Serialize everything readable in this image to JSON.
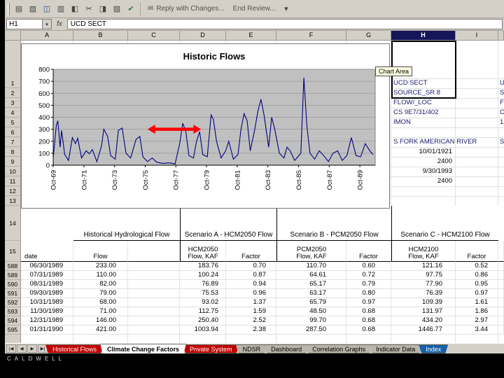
{
  "toolbar": {
    "icons": [
      {
        "name": "new-workbook",
        "glyph": "▤"
      },
      {
        "name": "open",
        "glyph": "▧"
      },
      {
        "name": "save",
        "glyph": "◫"
      },
      {
        "name": "print",
        "glyph": "▥"
      },
      {
        "name": "print-preview",
        "glyph": "◧"
      },
      {
        "name": "cut",
        "glyph": "✂"
      },
      {
        "name": "copy",
        "glyph": "◨"
      },
      {
        "name": "chart-wizard",
        "glyph": "▨"
      },
      {
        "name": "accept-change",
        "glyph": "✔"
      }
    ],
    "reply_icon_glyph": "✉",
    "reply_with_changes": "Reply with Changes...",
    "end_review": "End Review...",
    "overflow_glyph": "▾"
  },
  "formula_bar": {
    "name_box": "H1",
    "dropdown_glyph": "▾",
    "fx_label": "fx",
    "value": "UCD SECT"
  },
  "grid": {
    "columns": [
      "A",
      "B",
      "C",
      "D",
      "E",
      "F",
      "G",
      "H",
      "I"
    ],
    "selected_column": "H",
    "upper_row_numbers": [
      "1",
      "2",
      "3",
      "4",
      "5",
      "6",
      "7",
      "8",
      "9",
      "10",
      "11",
      "12",
      "13",
      "14",
      "15"
    ],
    "lower_row_numbers": [
      "588",
      "589",
      "590",
      "591",
      "592",
      "593",
      "594",
      "595"
    ]
  },
  "right_panel": {
    "h_cells": [
      "UCD SECT",
      "SOURCE_SR 8",
      "FLOW/_LOC",
      "CS 9E7/31/402",
      "IMON",
      "",
      "S FORK AMERICAN RIVER",
      "10/01/1921",
      "2400",
      "9/30/1993",
      "2400"
    ],
    "next_column_cells": [
      "U",
      "S",
      "F",
      "C",
      "1",
      "",
      "S",
      "",
      "",
      "",
      ""
    ]
  },
  "tooltip": {
    "label": "Chart Area"
  },
  "chart_data": {
    "type": "line",
    "title": "Historic Flows",
    "xlabel": "",
    "ylabel": "",
    "ylim": [
      0,
      800
    ],
    "y_ticks": [
      800,
      700,
      600,
      500,
      400,
      300,
      200,
      100,
      0
    ],
    "x_domain": [
      1969.75,
      1990.75
    ],
    "x_ticks": [
      1969.75,
      1971.75,
      1973.75,
      1975.75,
      1977.75,
      1979.75,
      1981.75,
      1983.75,
      1985.75,
      1987.75,
      1989.75
    ],
    "x_tick_labels": [
      "Oct-69",
      "Oct-71",
      "Oct-73",
      "Oct-75",
      "Oct-77",
      "Oct-79",
      "Oct-81",
      "Oct-83",
      "Oct-85",
      "Oct-87",
      "Oct-89"
    ],
    "grid": true,
    "legend": false,
    "plot_bg": "#c0c0c0",
    "series": [
      {
        "name": "Historic Flows",
        "color": "#000080",
        "points": [
          [
            1969.75,
            60
          ],
          [
            1969.95,
            330
          ],
          [
            1970.05,
            370
          ],
          [
            1970.2,
            150
          ],
          [
            1970.3,
            290
          ],
          [
            1970.5,
            90
          ],
          [
            1970.75,
            40
          ],
          [
            1971.0,
            230
          ],
          [
            1971.2,
            180
          ],
          [
            1971.35,
            225
          ],
          [
            1971.6,
            60
          ],
          [
            1971.9,
            120
          ],
          [
            1972.1,
            95
          ],
          [
            1972.3,
            130
          ],
          [
            1972.6,
            30
          ],
          [
            1972.9,
            160
          ],
          [
            1973.05,
            300
          ],
          [
            1973.3,
            240
          ],
          [
            1973.5,
            80
          ],
          [
            1973.8,
            50
          ],
          [
            1974.0,
            290
          ],
          [
            1974.25,
            310
          ],
          [
            1974.5,
            100
          ],
          [
            1974.8,
            60
          ],
          [
            1975.15,
            215
          ],
          [
            1975.4,
            240
          ],
          [
            1975.6,
            70
          ],
          [
            1975.9,
            30
          ],
          [
            1976.2,
            60
          ],
          [
            1976.5,
            25
          ],
          [
            1976.9,
            15
          ],
          [
            1977.3,
            20
          ],
          [
            1977.7,
            10
          ],
          [
            1978.0,
            180
          ],
          [
            1978.2,
            350
          ],
          [
            1978.4,
            280
          ],
          [
            1978.6,
            80
          ],
          [
            1978.9,
            60
          ],
          [
            1979.1,
            200
          ],
          [
            1979.3,
            280
          ],
          [
            1979.5,
            90
          ],
          [
            1979.8,
            70
          ],
          [
            1980.05,
            420
          ],
          [
            1980.2,
            380
          ],
          [
            1980.4,
            200
          ],
          [
            1980.7,
            60
          ],
          [
            1981.0,
            120
          ],
          [
            1981.2,
            200
          ],
          [
            1981.5,
            50
          ],
          [
            1981.8,
            90
          ],
          [
            1982.0,
            300
          ],
          [
            1982.2,
            430
          ],
          [
            1982.4,
            370
          ],
          [
            1982.6,
            120
          ],
          [
            1982.9,
            300
          ],
          [
            1983.1,
            450
          ],
          [
            1983.3,
            550
          ],
          [
            1983.5,
            420
          ],
          [
            1983.8,
            150
          ],
          [
            1984.0,
            400
          ],
          [
            1984.2,
            300
          ],
          [
            1984.5,
            100
          ],
          [
            1984.8,
            60
          ],
          [
            1985.0,
            150
          ],
          [
            1985.2,
            120
          ],
          [
            1985.5,
            40
          ],
          [
            1985.9,
            100
          ],
          [
            1986.1,
            730
          ],
          [
            1986.3,
            320
          ],
          [
            1986.5,
            100
          ],
          [
            1986.8,
            50
          ],
          [
            1987.1,
            120
          ],
          [
            1987.4,
            80
          ],
          [
            1987.7,
            30
          ],
          [
            1988.0,
            100
          ],
          [
            1988.3,
            120
          ],
          [
            1988.6,
            40
          ],
          [
            1988.9,
            80
          ],
          [
            1989.2,
            230
          ],
          [
            1989.5,
            80
          ],
          [
            1989.8,
            70
          ],
          [
            1990.1,
            180
          ],
          [
            1990.4,
            120
          ],
          [
            1990.6,
            90
          ]
        ]
      }
    ],
    "annotations": [
      {
        "type": "double-arrow",
        "x_start": 1975.9,
        "x_end": 1979.4,
        "y": 300,
        "color": "#ff0000"
      }
    ]
  },
  "table": {
    "group_headers": [
      "Historical Hydrological Flow",
      "Scenario A - HCM2050 Flow",
      "Scenario B - PCM2050 Flow",
      "Scenario C - HCM2100 Flow"
    ],
    "sub_headers": [
      "date",
      "Flow",
      "",
      "HCM2050\nFlow, KAF",
      "Factor",
      "PCM2050\nFlow, KAF",
      "Factor",
      "HCM2100\nFlow, KAF",
      "Factor",
      ""
    ],
    "rows": [
      [
        "06/30/1989",
        "233.00",
        "",
        "183.76",
        "0.70",
        "110.70",
        "0.60",
        "121.16",
        "0.52",
        ""
      ],
      [
        "07/31/1989",
        "110.00",
        "",
        "100.24",
        "0.87",
        "64.61",
        "0.72",
        "97.75",
        "0.86",
        ""
      ],
      [
        "08/31/1989",
        "82.00",
        "",
        "76.89",
        "0.94",
        "65.17",
        "0.79",
        "77.90",
        "0.95",
        ""
      ],
      [
        "09/30/1989",
        "79.00",
        "",
        "75.53",
        "0.96",
        "63.17",
        "0.80",
        "76.39",
        "0.97",
        ""
      ],
      [
        "10/31/1989",
        "68.00",
        "",
        "93.02",
        "1.37",
        "65.79",
        "0.97",
        "109.39",
        "1.61",
        ""
      ],
      [
        "11/30/1989",
        "71.00",
        "",
        "112.75",
        "1.59",
        "48.50",
        "0.68",
        "131.97",
        "1.86",
        ""
      ],
      [
        "12/31/1989",
        "146.00",
        "",
        "250.40",
        "2.52",
        "99.70",
        "0.68",
        "434.20",
        "2.97",
        ""
      ],
      [
        "01/31/1990",
        "421.00",
        "",
        "1003.94",
        "2.38",
        "287.50",
        "0.68",
        "1446.77",
        "3.44",
        ""
      ]
    ]
  },
  "tab_scroll": [
    "|◀",
    "◀",
    "▶",
    "▶|"
  ],
  "sheet_tabs": [
    {
      "label": "Historical Flows",
      "bg": "#c00000",
      "fg": "#ffffff",
      "active": false
    },
    {
      "label": "Climate Change Factors",
      "bg": "#ffffff",
      "fg": "#000000",
      "active": true
    },
    {
      "label": "Private System",
      "bg": "#c00000",
      "fg": "#ffffff",
      "active": false
    },
    {
      "label": "NDSR",
      "bg": "#b9b5ab",
      "fg": "#000000",
      "active": false
    },
    {
      "label": "Dashboard",
      "bg": "#b9b5ab",
      "fg": "#000000",
      "active": false
    },
    {
      "label": "Correlation Graphs",
      "bg": "#b9b5ab",
      "fg": "#000000",
      "active": false
    },
    {
      "label": "Indicator Data",
      "bg": "#b9b5ab",
      "fg": "#000000",
      "active": false
    },
    {
      "label": "Index",
      "bg": "#1560a8",
      "fg": "#ffffff",
      "active": false
    }
  ],
  "footer": {
    "watermark": "CALDWELL"
  }
}
